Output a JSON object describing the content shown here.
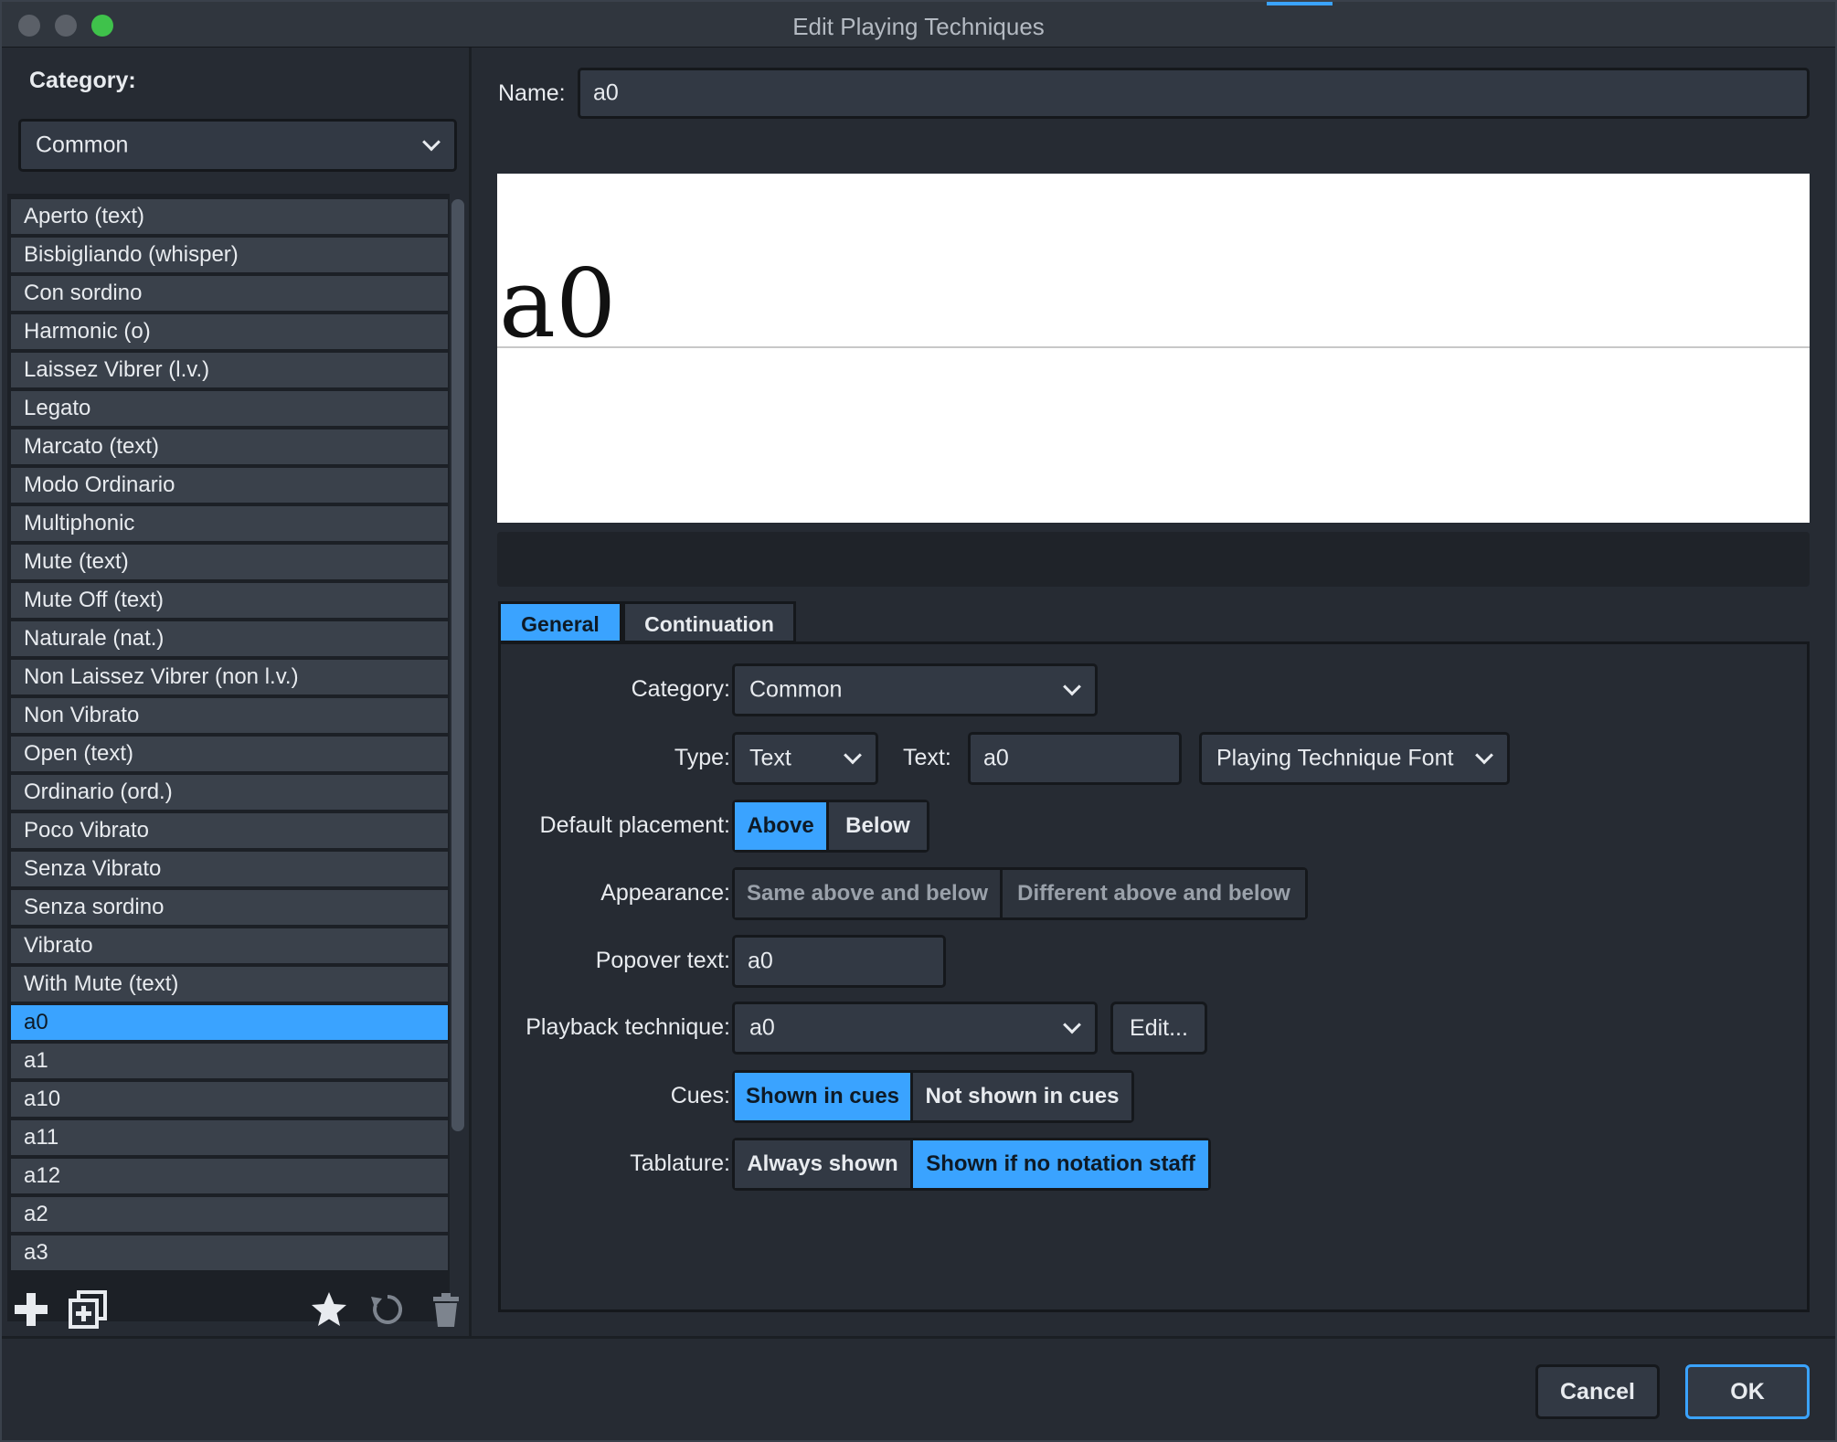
{
  "window": {
    "title": "Edit Playing Techniques"
  },
  "left": {
    "category_label": "Category:",
    "category_value": "Common",
    "items": [
      "Aperto (text)",
      "Bisbigliando (whisper)",
      "Con sordino",
      "Harmonic (o)",
      "Laissez Vibrer (l.v.)",
      "Legato",
      "Marcato (text)",
      "Modo Ordinario",
      "Multiphonic",
      "Mute (text)",
      "Mute Off (text)",
      "Naturale (nat.)",
      "Non Laissez Vibrer (non l.v.)",
      "Non Vibrato",
      "Open (text)",
      "Ordinario (ord.)",
      "Poco Vibrato",
      "Senza Vibrato",
      "Senza sordino",
      "Vibrato",
      "With Mute (text)",
      "a0",
      "a1",
      "a10",
      "a11",
      "a12",
      "a2",
      "a3"
    ],
    "selected_item": "a0",
    "toolbar_icons": [
      "plus-icon",
      "duplicate-icon",
      "star-icon",
      "reset-icon",
      "trash-icon"
    ]
  },
  "name": {
    "label": "Name:",
    "value": "a0"
  },
  "preview": {
    "text": "a0"
  },
  "tabs": [
    {
      "label": "General",
      "active": true
    },
    {
      "label": "Continuation",
      "active": false
    }
  ],
  "general": {
    "category": {
      "label": "Category:",
      "value": "Common"
    },
    "type": {
      "label": "Type:",
      "value": "Text"
    },
    "text": {
      "label": "Text:",
      "value": "a0"
    },
    "font": {
      "value": "Playing Technique Font"
    },
    "placement": {
      "label": "Default placement:",
      "options": [
        "Above",
        "Below"
      ],
      "selected": "Above"
    },
    "appearance": {
      "label": "Appearance:",
      "options": [
        "Same above and below",
        "Different above and below"
      ]
    },
    "popover": {
      "label": "Popover text:",
      "value": "a0"
    },
    "playback": {
      "label": "Playback technique:",
      "value": "a0",
      "edit_label": "Edit..."
    },
    "cues": {
      "label": "Cues:",
      "options": [
        "Shown in cues",
        "Not shown in cues"
      ],
      "selected": "Shown in cues"
    },
    "tablature": {
      "label": "Tablature:",
      "options": [
        "Always shown",
        "Shown if no notation staff"
      ],
      "selected": "Shown if no notation staff"
    }
  },
  "footer": {
    "cancel_label": "Cancel",
    "ok_label": "OK"
  },
  "colors": {
    "accent": "#3aa3ff",
    "background": "#262b33",
    "control": "#323944",
    "maximize": "#3fc24b"
  }
}
